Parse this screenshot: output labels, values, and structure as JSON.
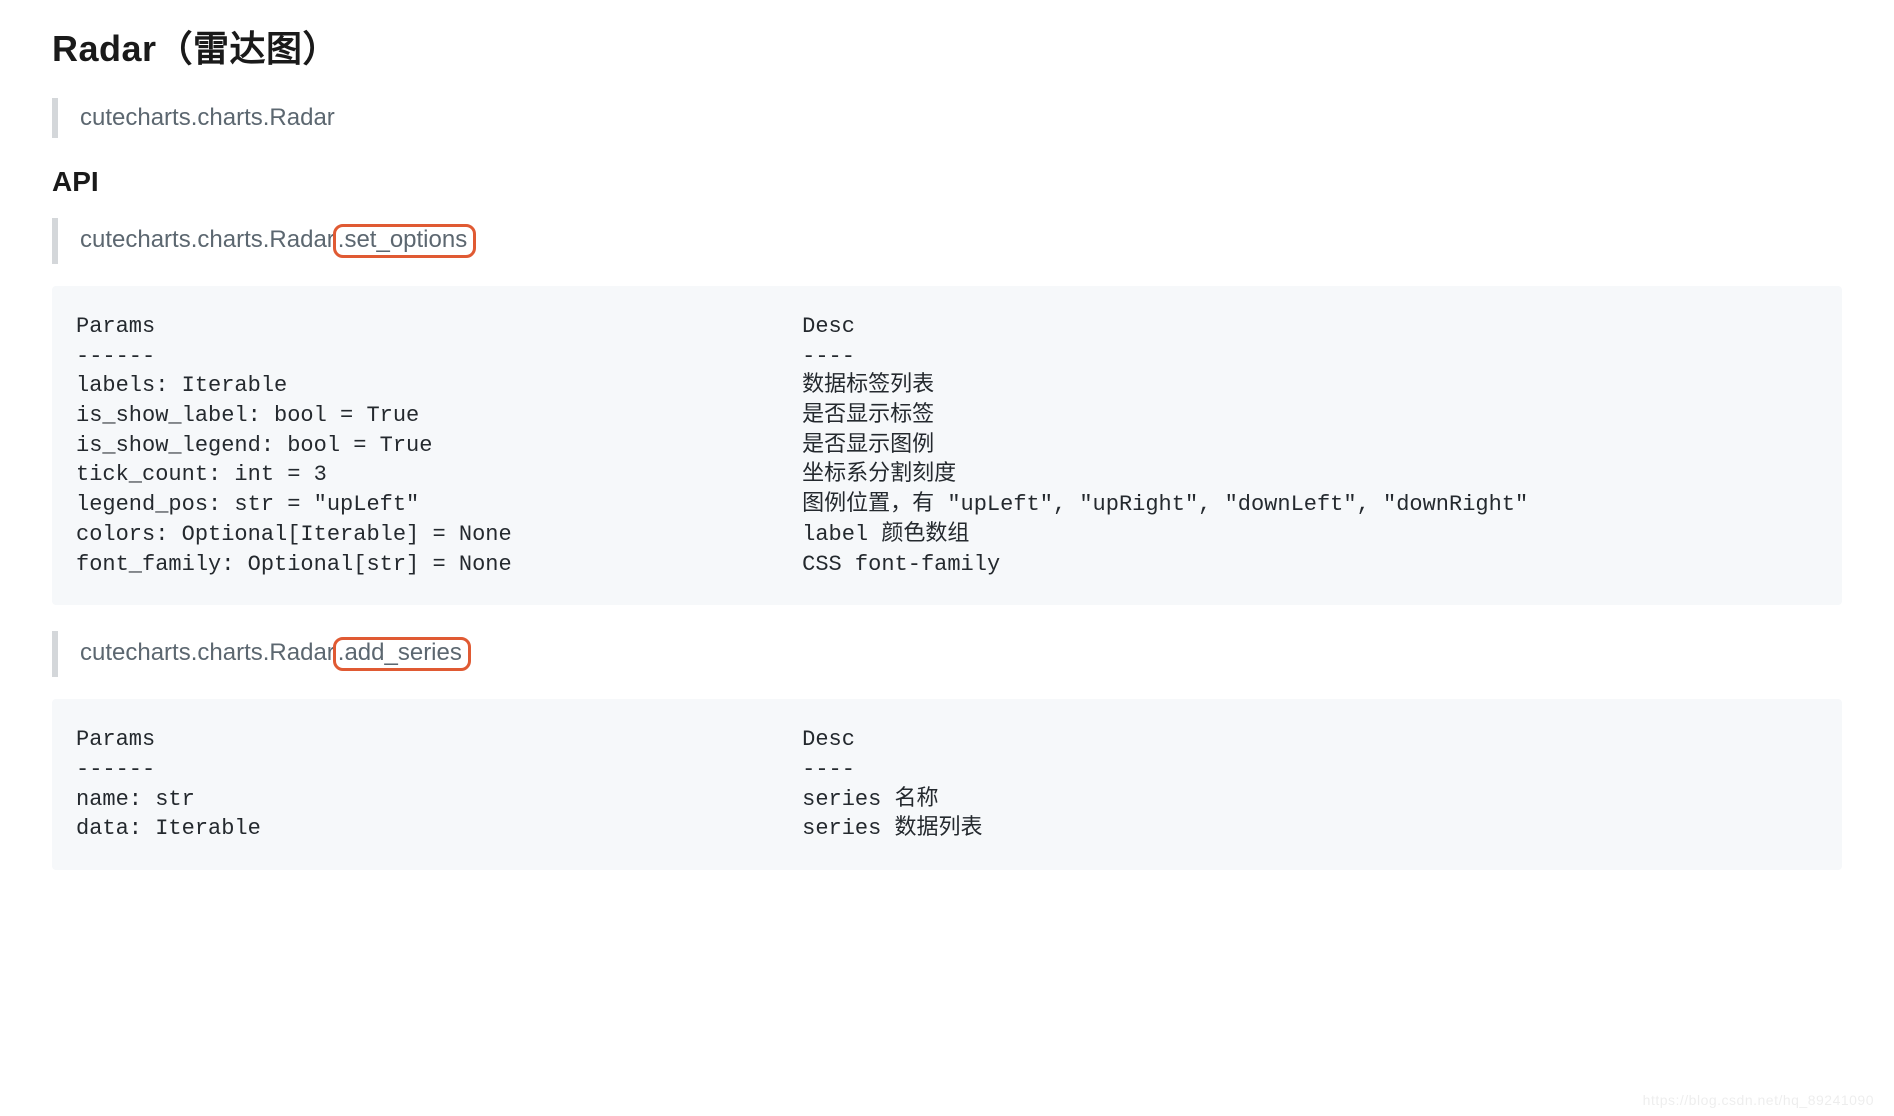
{
  "title": "Radar（雷达图）",
  "module_path": "cutecharts.charts.Radar",
  "api_heading": "API",
  "methods": [
    {
      "prefix": "cutecharts.charts.Radar",
      "name": ".set_options",
      "code": "Params                                                 Desc\n------                                                 ----\nlabels: Iterable                                       数据标签列表\nis_show_label: bool = True                             是否显示标签\nis_show_legend: bool = True                            是否显示图例\ntick_count: int = 3                                    坐标系分割刻度\nlegend_pos: str = \"upLeft\"                             图例位置，有 \"upLeft\", \"upRight\", \"downLeft\", \"downRight\"\ncolors: Optional[Iterable] = None                      label 颜色数组\nfont_family: Optional[str] = None                      CSS font-family"
    },
    {
      "prefix": "cutecharts.charts.Radar",
      "name": ".add_series",
      "code": "Params                                                 Desc\n------                                                 ----\nname: str                                              series 名称\ndata: Iterable                                         series 数据列表"
    }
  ],
  "watermark": "https://blog.csdn.net/hq_89241090"
}
